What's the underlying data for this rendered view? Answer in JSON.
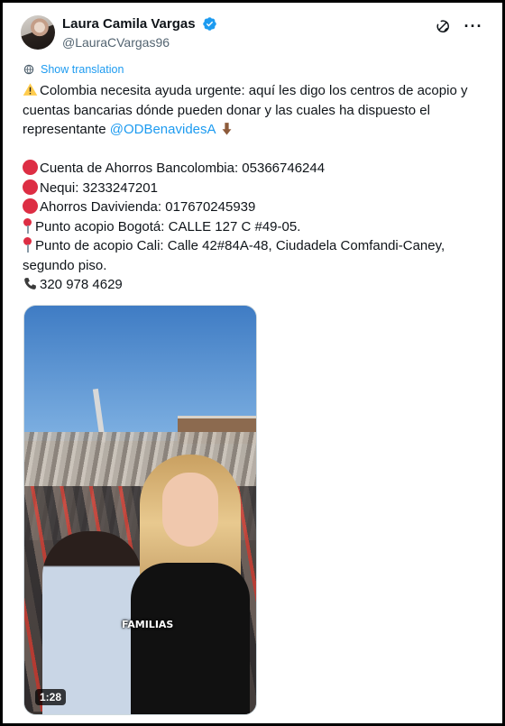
{
  "author": {
    "display_name": "Laura Camila Vargas",
    "handle": "@LauraCVargas96",
    "verified": true
  },
  "header_icons": [
    "grok-icon",
    "more-icon"
  ],
  "translate": {
    "label": "Show translation",
    "icon": "globe-icon"
  },
  "tweet": {
    "intro": "Colombia necesita ayuda urgente: aquí les digo los centros de acopio y cuentas bancarias dónde pueden donar y las cuales ha dispuesto el representante ",
    "mention": "@ODBenavidesA",
    "lines": [
      {
        "icon": "red-circle-icon",
        "text": "Cuenta de Ahorros Bancolombia: 05366746244"
      },
      {
        "icon": "red-circle-icon",
        "text": "Nequi: 3233247201"
      },
      {
        "icon": "red-circle-icon",
        "text": "Ahorros Davivienda: 017670245939"
      },
      {
        "icon": "pin-icon",
        "text": "Punto acopio Bogotá: CALLE 127 C #49-05."
      },
      {
        "icon": "pin-icon",
        "text": "Punto de acopio Cali: Calle 42#84A-48, Ciudadela Comfandi-Caney, segundo piso."
      },
      {
        "icon": "phone-icon",
        "text": "320 978 4629"
      }
    ]
  },
  "media": {
    "caption_overlay": "FAMILIAS",
    "duration": "1:28"
  },
  "colors": {
    "accent": "#1d9bf0",
    "text": "#0f1419",
    "secondary": "#536471"
  }
}
